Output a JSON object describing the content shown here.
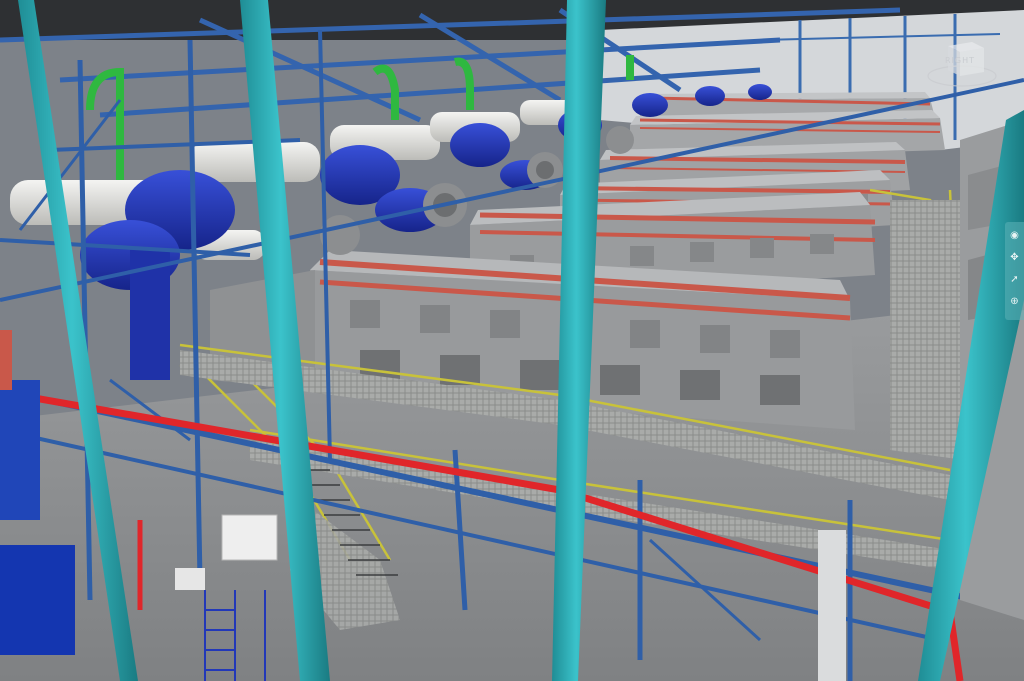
{
  "viewport": {
    "colors": {
      "ceiling": "#2e3033",
      "back_wall": "#d4d7da",
      "floor": "#8c8e90",
      "structural_steel": "#2f5fa8",
      "columns": "#2aa6ae",
      "engine_body": "#9a9c9e",
      "engine_top": "#bfc1c3",
      "exhaust_pipes": "#c9584a",
      "turbochargers": "#2238b8",
      "insulated_ducts": "#e6e6e3",
      "green_pipes": "#2fb840",
      "handrails": "#c8c23a",
      "red_fire_main": "#e0262a",
      "grating": "#a8aaa8"
    },
    "engine_count": 6
  },
  "viewcube": {
    "label": "RIGHT"
  },
  "nav_bar": {
    "buttons": [
      {
        "icon": "orbit-icon",
        "glyph": "◉"
      },
      {
        "icon": "pan-icon",
        "glyph": "✥"
      },
      {
        "icon": "select-arrow-icon",
        "glyph": "➚"
      },
      {
        "icon": "zoom-icon",
        "glyph": "⊕"
      }
    ]
  }
}
